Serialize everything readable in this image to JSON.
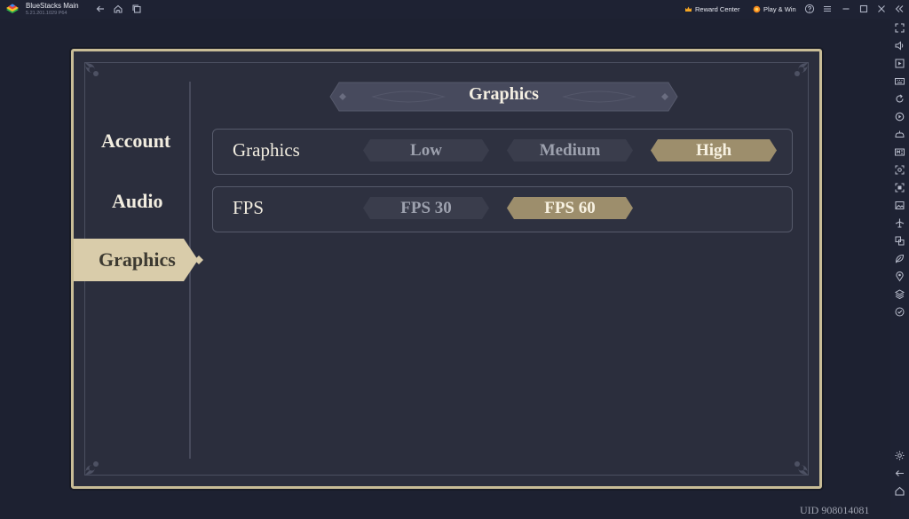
{
  "window": {
    "title": "BlueStacks Main",
    "version": "5.21.201.1029  P64"
  },
  "titlebar": {
    "reward_center_label": "Reward Center",
    "play_win_label": "Play & Win"
  },
  "game": {
    "header_title": "Graphics",
    "nav": [
      {
        "label": "Account",
        "active": false
      },
      {
        "label": "Audio",
        "active": false
      },
      {
        "label": "Graphics",
        "active": true
      }
    ],
    "settings": [
      {
        "label": "Graphics",
        "options": [
          {
            "label": "Low",
            "selected": false
          },
          {
            "label": "Medium",
            "selected": false
          },
          {
            "label": "High",
            "selected": true
          }
        ]
      },
      {
        "label": "FPS",
        "options": [
          {
            "label": "FPS 30",
            "selected": false
          },
          {
            "label": "FPS 60",
            "selected": true
          }
        ]
      }
    ],
    "uid": "UID 908014081"
  },
  "colors": {
    "accent_gold": "#9d8e6c",
    "frame_gold": "#c9bd97",
    "panel_bg": "#2b2e3d",
    "option_bg": "#3a3d4c",
    "bluestacks_bar": "#1e2233"
  },
  "icons": {
    "titlebar": [
      "back-icon",
      "home-icon",
      "multi-instance-icon",
      "help-icon",
      "menu-icon",
      "minimize-icon",
      "maximize-icon",
      "close-icon",
      "collapse-sidebar-icon"
    ],
    "sidebar": [
      "fullscreen-icon",
      "volume-icon",
      "media-manager-icon",
      "keyboard-controls-icon",
      "rotate-icon",
      "replay-icon",
      "gamepad-icon",
      "macro-icon",
      "screenshot-icon",
      "record-icon",
      "gallery-icon",
      "airplane-icon",
      "multi-instance-sync-icon",
      "eco-mode-icon",
      "location-icon",
      "layers-icon",
      "realtime-translate-icon",
      "settings-icon",
      "back-nav-icon",
      "home-nav-icon"
    ]
  }
}
